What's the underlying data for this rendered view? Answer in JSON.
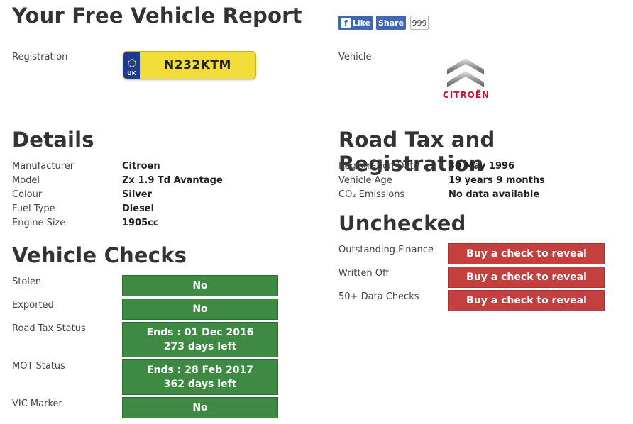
{
  "page_title": "Your Free Vehicle Report",
  "social": {
    "like_label": "Like",
    "share_label": "Share",
    "share_count": "999"
  },
  "registration": {
    "label": "Registration",
    "plate_country": "UK",
    "plate_number": "N232KTM"
  },
  "vehicle": {
    "label": "Vehicle",
    "brand_logo_text": "CITROËN"
  },
  "details": {
    "heading": "Details",
    "rows": [
      {
        "label": "Manufacturer",
        "value": "Citroen"
      },
      {
        "label": "Model",
        "value": "Zx 1.9 Td Avantage"
      },
      {
        "label": "Colour",
        "value": "Silver"
      },
      {
        "label": "Fuel Type",
        "value": "Diesel"
      },
      {
        "label": "Engine Size",
        "value": "1905cc"
      }
    ]
  },
  "road_tax": {
    "heading": "Road Tax and Registration",
    "rows": [
      {
        "label": "Registration Date",
        "value": "30 May 1996"
      },
      {
        "label": "Vehicle Age",
        "value": "19 years 9 months"
      },
      {
        "label": "CO₂ Emissions",
        "value": "No data available"
      }
    ]
  },
  "vehicle_checks": {
    "heading": "Vehicle Checks",
    "rows": [
      {
        "label": "Stolen",
        "line1": "No",
        "line2": ""
      },
      {
        "label": "Exported",
        "line1": "No",
        "line2": ""
      },
      {
        "label": "Road Tax Status",
        "line1": "Ends : 01 Dec 2016",
        "line2": "273 days left"
      },
      {
        "label": "MOT Status",
        "line1": "Ends : 28 Feb 2017",
        "line2": "362 days left"
      },
      {
        "label": "VIC Marker",
        "line1": "No",
        "line2": ""
      }
    ],
    "status_color": "#3e8a43"
  },
  "unchecked": {
    "heading": "Unchecked",
    "rows": [
      {
        "label": "Outstanding Finance",
        "button": "Buy a check to reveal"
      },
      {
        "label": "Written Off",
        "button": "Buy a check to reveal"
      },
      {
        "label": "50+ Data Checks",
        "button": "Buy a check to reveal"
      }
    ],
    "button_color": "#c4403f"
  }
}
